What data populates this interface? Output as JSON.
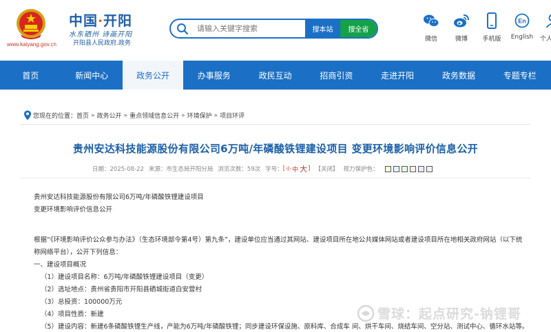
{
  "header": {
    "site_url": "www.kaiyang.gov.cn",
    "logo_main_a": "中国",
    "logo_main_dot": "·",
    "logo_main_b": "开阳",
    "logo_slogan": "水东硒州 诗画开阳",
    "logo_sub": "开阳县人民政府.政务"
  },
  "search": {
    "placeholder": "请输入关键字搜索",
    "site_button": "搜本站",
    "all_button": "搜全省"
  },
  "top_links": [
    {
      "label": "微信",
      "icon": "wechat-icon"
    },
    {
      "label": "微博",
      "icon": "weibo-icon"
    },
    {
      "label": "手机版",
      "icon": "mobile-icon"
    },
    {
      "label": "English",
      "icon": "english-icon"
    },
    {
      "label": "个人中心",
      "icon": "user-icon"
    }
  ],
  "nav": {
    "items": [
      "首页",
      "新闻中心",
      "政务公开",
      "办事服务",
      "政民互动",
      "招商引资",
      "走进开阳",
      "政务数据",
      "专题专栏"
    ],
    "active_index": 2
  },
  "breadcrumb": {
    "prefix": "您现在的位置：",
    "items": [
      "首页",
      "政务公开",
      "重点领域信息公开",
      "环境保护",
      "项目环评"
    ],
    "separator": "»"
  },
  "article": {
    "title": "贵州安达科技能源股份有限公司6万吨/年磷酸铁锂建设项目 变更环境影响评价信息公开",
    "meta": {
      "date": "日期：2025-08-22",
      "source": "来源：市生态局开阳分局",
      "views": "浏览次数：59次",
      "font_label": "字号：",
      "font_small": "小",
      "font_medium": "中",
      "font_large": "大",
      "close_label": "【关闭】",
      "theme_label": "视力保护色："
    },
    "swatch_colors": [
      "#fffde0",
      "#e4f4ff",
      "#e6f7e6",
      "#fff0e8",
      "#f0e8ff",
      "#f2f2f2"
    ],
    "paragraphs": [
      "贵州安达科技能源股份有限公司6万吨/年磷酸铁锂建设项目",
      "变更环境影响评价信息公开",
      "根据“《环境影响评价公众参与办法》（生态环境部令第4号）第九条”，建设单位应当通过其网站、建设项目所在地公共媒体网站或者建设项目所在地相关政府网站（以下统称网络平台），公开下列信息：",
      "一、建设项目概况",
      "（1）建设项目名称：6万吨/年磷酸铁锂建设项目（变更）",
      "（2）选址地点：贵州省贵阳市开阳县硒城街道白安营村",
      "（3）总投资：100000万元",
      "（4）项目性质：新建",
      "（5）建设内容：新建6条磷酸铁锂生产线，产能为6万吨/年磷酸铁锂；同步建设环保设施、原料库、合成车 间、烘干车间、烧结车间、空分站、测试中心、循环水站等。"
    ]
  },
  "watermark": "雪球：起点研究-钠锂哥"
}
